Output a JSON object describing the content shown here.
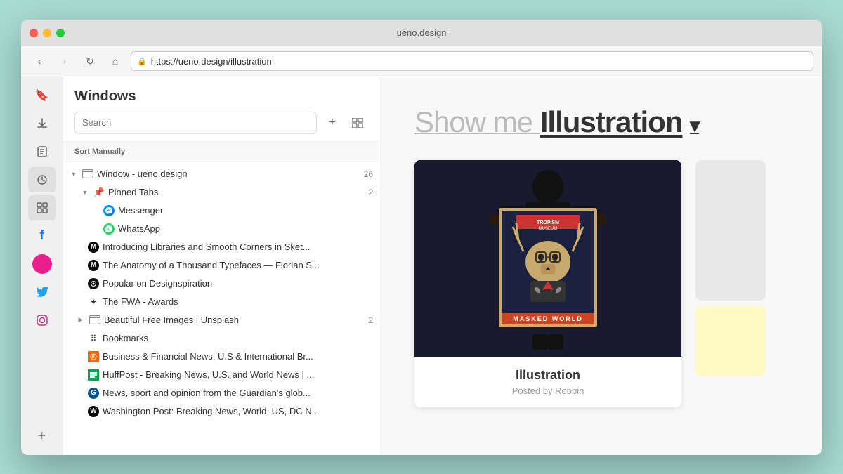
{
  "browser": {
    "title": "ueno.design",
    "url": "https://ueno.design/illustration",
    "back_btn": "‹",
    "forward_btn": "›",
    "reload_btn": "↻",
    "home_btn": "⌂"
  },
  "sidebar_icons": {
    "bookmark_icon": "🔖",
    "download_icon": "⬇",
    "notes_icon": "📋",
    "history_icon": "🕐",
    "windows_icon": "▦",
    "facebook_icon": "f",
    "twitter_icon": "🐦",
    "instagram_icon": "◎",
    "add_icon": "+"
  },
  "panel": {
    "title": "Windows",
    "search_placeholder": "Search",
    "sort_label": "Sort Manually",
    "add_label": "+",
    "grid_label": "⊞"
  },
  "tree": {
    "window_item": {
      "label": "Window - ueno.design",
      "count": "26"
    },
    "pinned_tabs": {
      "label": "Pinned Tabs",
      "count": "2"
    },
    "items": [
      {
        "id": "messenger",
        "label": "Messenger",
        "indent": 4,
        "type": "messenger"
      },
      {
        "id": "whatsapp",
        "label": "WhatsApp",
        "indent": 4,
        "type": "whatsapp"
      },
      {
        "id": "libraries",
        "label": "Introducing Libraries and Smooth Corners in Sket...",
        "indent": 2,
        "type": "medium"
      },
      {
        "id": "anatomy",
        "label": "The Anatomy of a Thousand Typefaces — Florian S...",
        "indent": 2,
        "type": "medium"
      },
      {
        "id": "designspiration",
        "label": "Popular on Designspiration",
        "indent": 2,
        "type": "designspiration"
      },
      {
        "id": "fwa",
        "label": "The FWA - Awards",
        "indent": 2,
        "type": "fwa"
      },
      {
        "id": "unsplash",
        "label": "Beautiful Free Images | Unsplash",
        "indent": 2,
        "count": "2",
        "type": "unsplash",
        "has_chevron": true
      },
      {
        "id": "bookmarks",
        "label": "Bookmarks",
        "indent": 2,
        "type": "bookmarks"
      },
      {
        "id": "business",
        "label": "Business & Financial News, U.S & International Br...",
        "indent": 2,
        "type": "business"
      },
      {
        "id": "huffpost",
        "label": "HuffPost - Breaking News, U.S. and World News | ...",
        "indent": 2,
        "type": "huffpost"
      },
      {
        "id": "guardian",
        "label": "News, sport and opinion from the Guardian's glob...",
        "indent": 2,
        "type": "guardian"
      },
      {
        "id": "washpost",
        "label": "Washington Post: Breaking News, World, US, DC N...",
        "indent": 2,
        "type": "washpost"
      }
    ]
  },
  "content": {
    "heading_prefix": "Show me ",
    "heading_main": "Illustration",
    "heading_arrow": "▾",
    "card": {
      "title": "Illustration",
      "subtitle": "Posted by Robbin"
    }
  }
}
